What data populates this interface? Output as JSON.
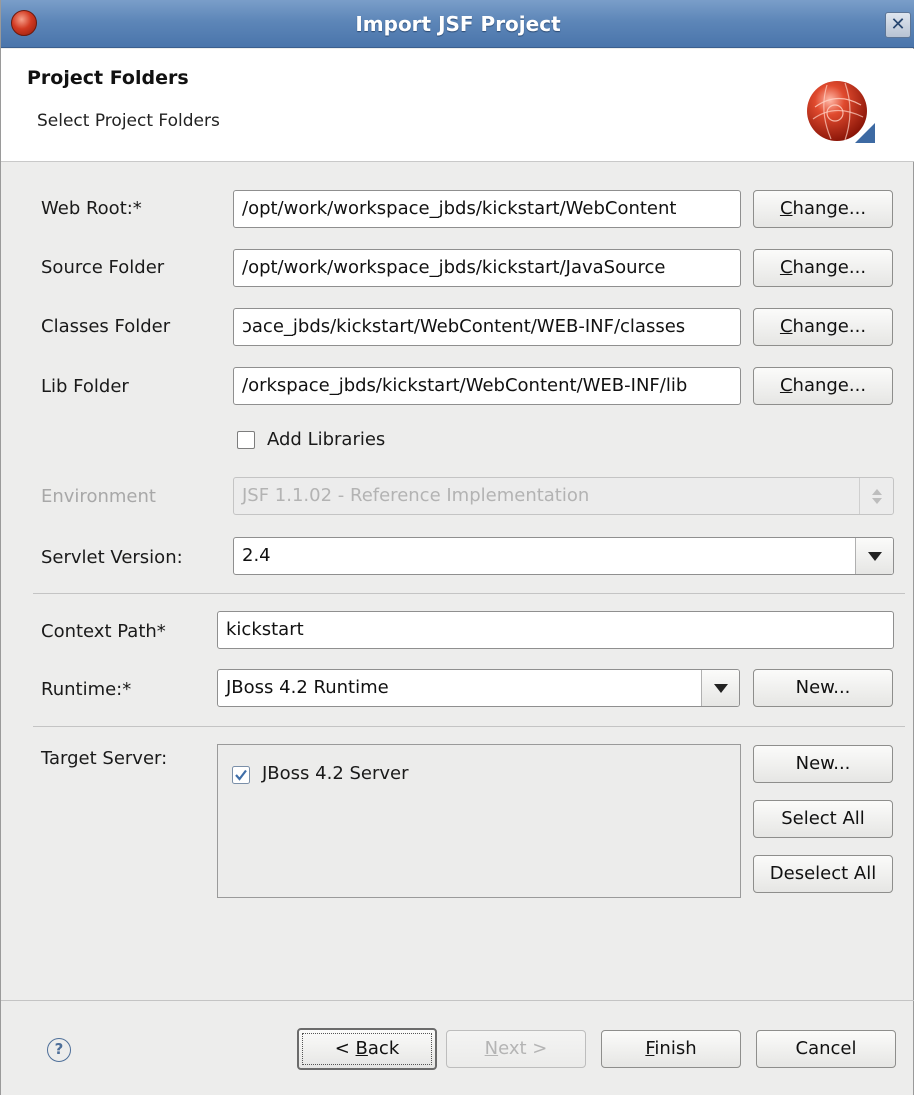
{
  "window": {
    "title": "Import JSF Project",
    "close_glyph": "✕"
  },
  "banner": {
    "heading": "Project Folders",
    "subheading": "Select Project Folders",
    "logo_icon": "jboss-orb-logo-icon"
  },
  "form": {
    "web_root": {
      "label": "Web Root:*",
      "value": "/opt/work/workspace_jbds/kickstart/WebContent",
      "button_prefix": "",
      "button_mnemonic": "C",
      "button_rest": "hange..."
    },
    "source_folder": {
      "label": "Source Folder",
      "value": "/opt/work/workspace_jbds/kickstart/JavaSource",
      "button_mnemonic": "C",
      "button_rest": "hange..."
    },
    "classes_folder": {
      "label": "Classes Folder",
      "value": "ɔace_jbds/kickstart/WebContent/WEB-INF/classes",
      "button_mnemonic": "C",
      "button_rest": "hange..."
    },
    "lib_folder": {
      "label": "Lib Folder",
      "value": "/orkspace_jbds/kickstart/WebContent/WEB-INF/lib",
      "button_mnemonic": "C",
      "button_rest": "hange..."
    },
    "add_libraries": {
      "label": "Add Libraries",
      "checked": false
    },
    "environment": {
      "label": "Environment",
      "value": "JSF 1.1.02 - Reference Implementation",
      "enabled": false
    },
    "servlet_version": {
      "label": "Servlet Version:",
      "value": "2.4"
    },
    "context_path": {
      "label": "Context Path*",
      "value": "kickstart"
    },
    "runtime": {
      "label": "Runtime:*",
      "value": "JBoss 4.2 Runtime",
      "new_button": "New..."
    },
    "target_server": {
      "label": "Target Server:",
      "items": [
        {
          "label": "JBoss 4.2 Server",
          "checked": true
        }
      ],
      "new_button": "New...",
      "select_all_button": "Select All",
      "deselect_all_button": "Deselect All"
    }
  },
  "footer": {
    "help_glyph": "?",
    "back_prefix": "< ",
    "back_mnemonic": "B",
    "back_rest": "ack",
    "next_mnemonic": "N",
    "next_rest": "ext >",
    "finish_mnemonic": "F",
    "finish_rest": "inish",
    "cancel": "Cancel"
  },
  "colors": {
    "titlebar": "#5d86b8",
    "window_bg": "#ededec",
    "logo_red": "#d23a22"
  }
}
